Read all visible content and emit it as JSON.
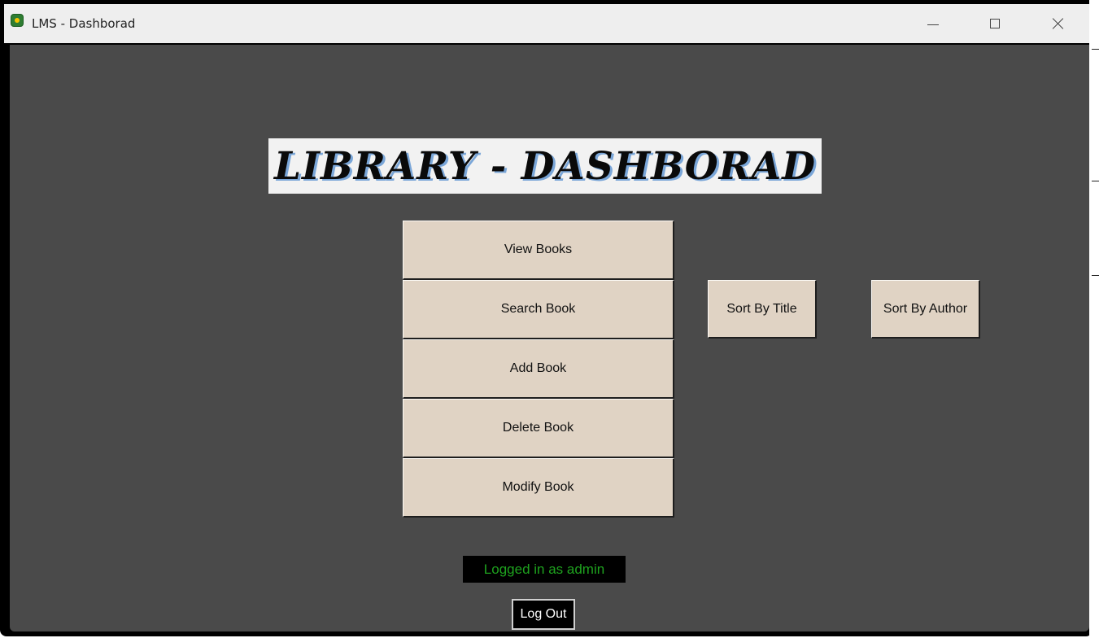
{
  "window": {
    "title": "LMS - Dashborad",
    "minimize_icon": "minimize-icon",
    "maximize_icon": "maximize-icon",
    "close_icon": "close-icon"
  },
  "heading": "LIBRARY - DASHBORAD",
  "menu": {
    "view_books": "View Books",
    "search_book": "Search Book",
    "add_book": "Add Book",
    "delete_book": "Delete Book",
    "modify_book": "Modify Book"
  },
  "sort": {
    "by_title": "Sort By Title",
    "by_author": "Sort By Author"
  },
  "status_text": "Logged in as admin",
  "logout_label": "Log Out",
  "colors": {
    "background": "#4a4a4a",
    "button": "#e0d3c4",
    "status_text": "#1ea21e",
    "heading_shadow": "#7aa6d8"
  }
}
